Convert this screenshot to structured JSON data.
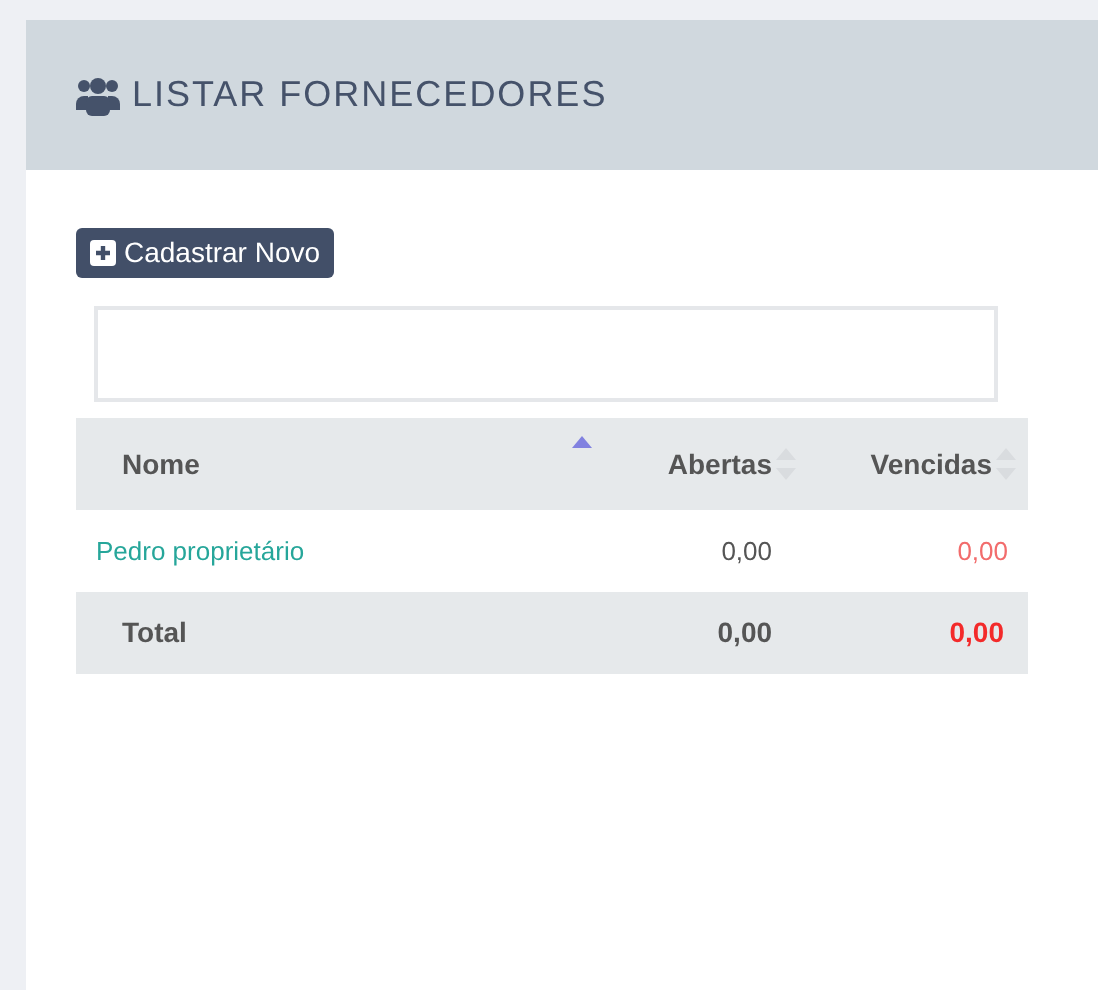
{
  "panel": {
    "title": "LISTAR FORNECEDORES"
  },
  "new_button": {
    "label": "Cadastrar Novo"
  },
  "table": {
    "columns": [
      {
        "label": "Nome",
        "sorted": true
      },
      {
        "label": "Abertas",
        "sorted": false
      },
      {
        "label": "Vencidas",
        "sorted": false
      }
    ],
    "rows": [
      {
        "name": "Pedro proprietário",
        "abertas": "0,00",
        "vencidas": "0,00"
      }
    ],
    "total": {
      "label": "Total",
      "abertas": "0,00",
      "vencidas": "0,00"
    }
  }
}
